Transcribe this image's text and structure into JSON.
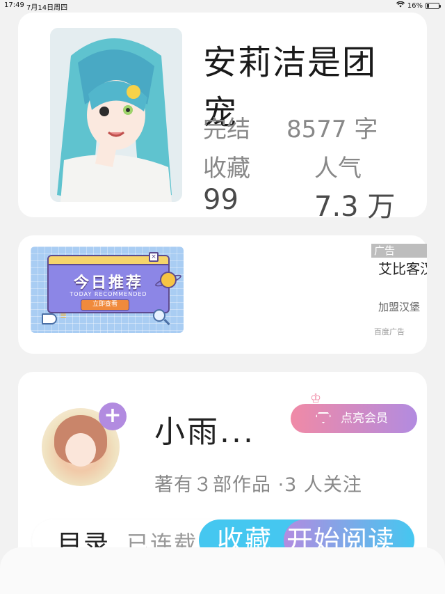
{
  "status_bar": {
    "time": "17:49",
    "date": "7月14日周四",
    "battery": "16%",
    "battery_level": 0.16
  },
  "book": {
    "title": "安莉洁是团宠",
    "status": "完结",
    "word_count": "8577 字",
    "favorites_label": "收藏",
    "popularity_label": "人气",
    "favorites_value": "99",
    "popularity_value": "7.3 万"
  },
  "ad": {
    "banner_headline": "今日推荐",
    "banner_subtitle": "TODAY RECOMMENDED",
    "banner_button": "立即查看",
    "banner_close": "×",
    "tag": "广告",
    "title": "艾比客汉",
    "description": "加盟汉堡",
    "source": "百度广告"
  },
  "author": {
    "name": "小雨...",
    "follow_symbol": "+",
    "vip_button": "点亮会员",
    "info": "著有３部作品 ·3 人关注"
  },
  "bottom_bar": {
    "toc": "目录",
    "serial_status": "已连载",
    "favorite": "收藏",
    "read": "开始阅读"
  },
  "colors": {
    "accent_blue": "#45c7f0",
    "accent_purple": "#b28be0",
    "vip_pink": "#f08aa6",
    "background": "#f2f2f2"
  }
}
